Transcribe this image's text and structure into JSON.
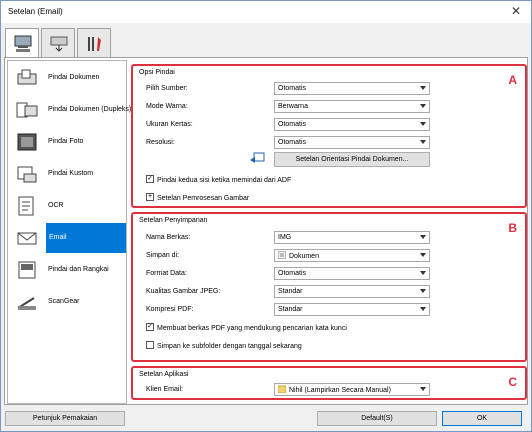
{
  "window": {
    "title": "Setelan (Email)",
    "close_glyph": "✕"
  },
  "tabs": [
    {
      "name": "scan-from-computer-icon"
    },
    {
      "name": "scan-from-panel-icon"
    },
    {
      "name": "tools-icon"
    }
  ],
  "sidebar": {
    "items": [
      {
        "label": "Pindai Dokumen",
        "icon": "document-scan-icon"
      },
      {
        "label": "Pindai Dokumen (Dupleks)",
        "icon": "duplex-scan-icon"
      },
      {
        "label": "Pindai Foto",
        "icon": "photo-scan-icon"
      },
      {
        "label": "Pindai Kustom",
        "icon": "custom-scan-icon"
      },
      {
        "label": "OCR",
        "icon": "ocr-icon"
      },
      {
        "label": "Email",
        "icon": "email-icon",
        "active": true
      },
      {
        "label": "Pindai dan Rangkai",
        "icon": "stitch-icon"
      },
      {
        "label": "ScanGear",
        "icon": "scangear-icon"
      }
    ]
  },
  "scan_options": {
    "header": "Opsi Pindai",
    "letter": "A",
    "source_label": "Pilih Sumber:",
    "source_value": "Otomatis",
    "color_label": "Mode Warna:",
    "color_value": "Berwarna",
    "paper_label": "Ukuran Kertas:",
    "paper_value": "Otomatis",
    "res_label": "Resolusi:",
    "res_value": "Otomatis",
    "orientation_button": "Setelan Orientasi Pindai Dokumen...",
    "duplex_check": "Pindai kedua sisi ketika memindai dari ADF",
    "image_processing": "Setelan Pemrosesan Gambar",
    "plus": "+"
  },
  "save_settings": {
    "header": "Setelan Penyimpanan",
    "letter": "B",
    "filename_label": "Nama Berkas:",
    "filename_value": "IMG",
    "savein_label": "Simpan di:",
    "savein_value": "Dokumen",
    "format_label": "Format Data:",
    "format_value": "Otomatis",
    "jpeg_label": "Kualitas Gambar JPEG:",
    "jpeg_value": "Standar",
    "pdf_label": "Kompresi PDF:",
    "pdf_value": "Standar",
    "keyword_check": "Membuat berkas PDF yang mendukung pencarian kata kunci",
    "keyword_checked": true,
    "subfolder_check": "Simpan ke subfolder dengan tanggal sekarang",
    "subfolder_checked": false,
    "check_mark": "✓"
  },
  "app_settings": {
    "header": "Setelan Aplikasi",
    "letter": "C",
    "client_label": "Klien Email:",
    "client_value": "Nihil (Lampirkan Secara Manual)"
  },
  "footer": {
    "help_button": "Petunjuk Pemakaian",
    "default_button": "Default(S)",
    "ok_button": "OK"
  }
}
